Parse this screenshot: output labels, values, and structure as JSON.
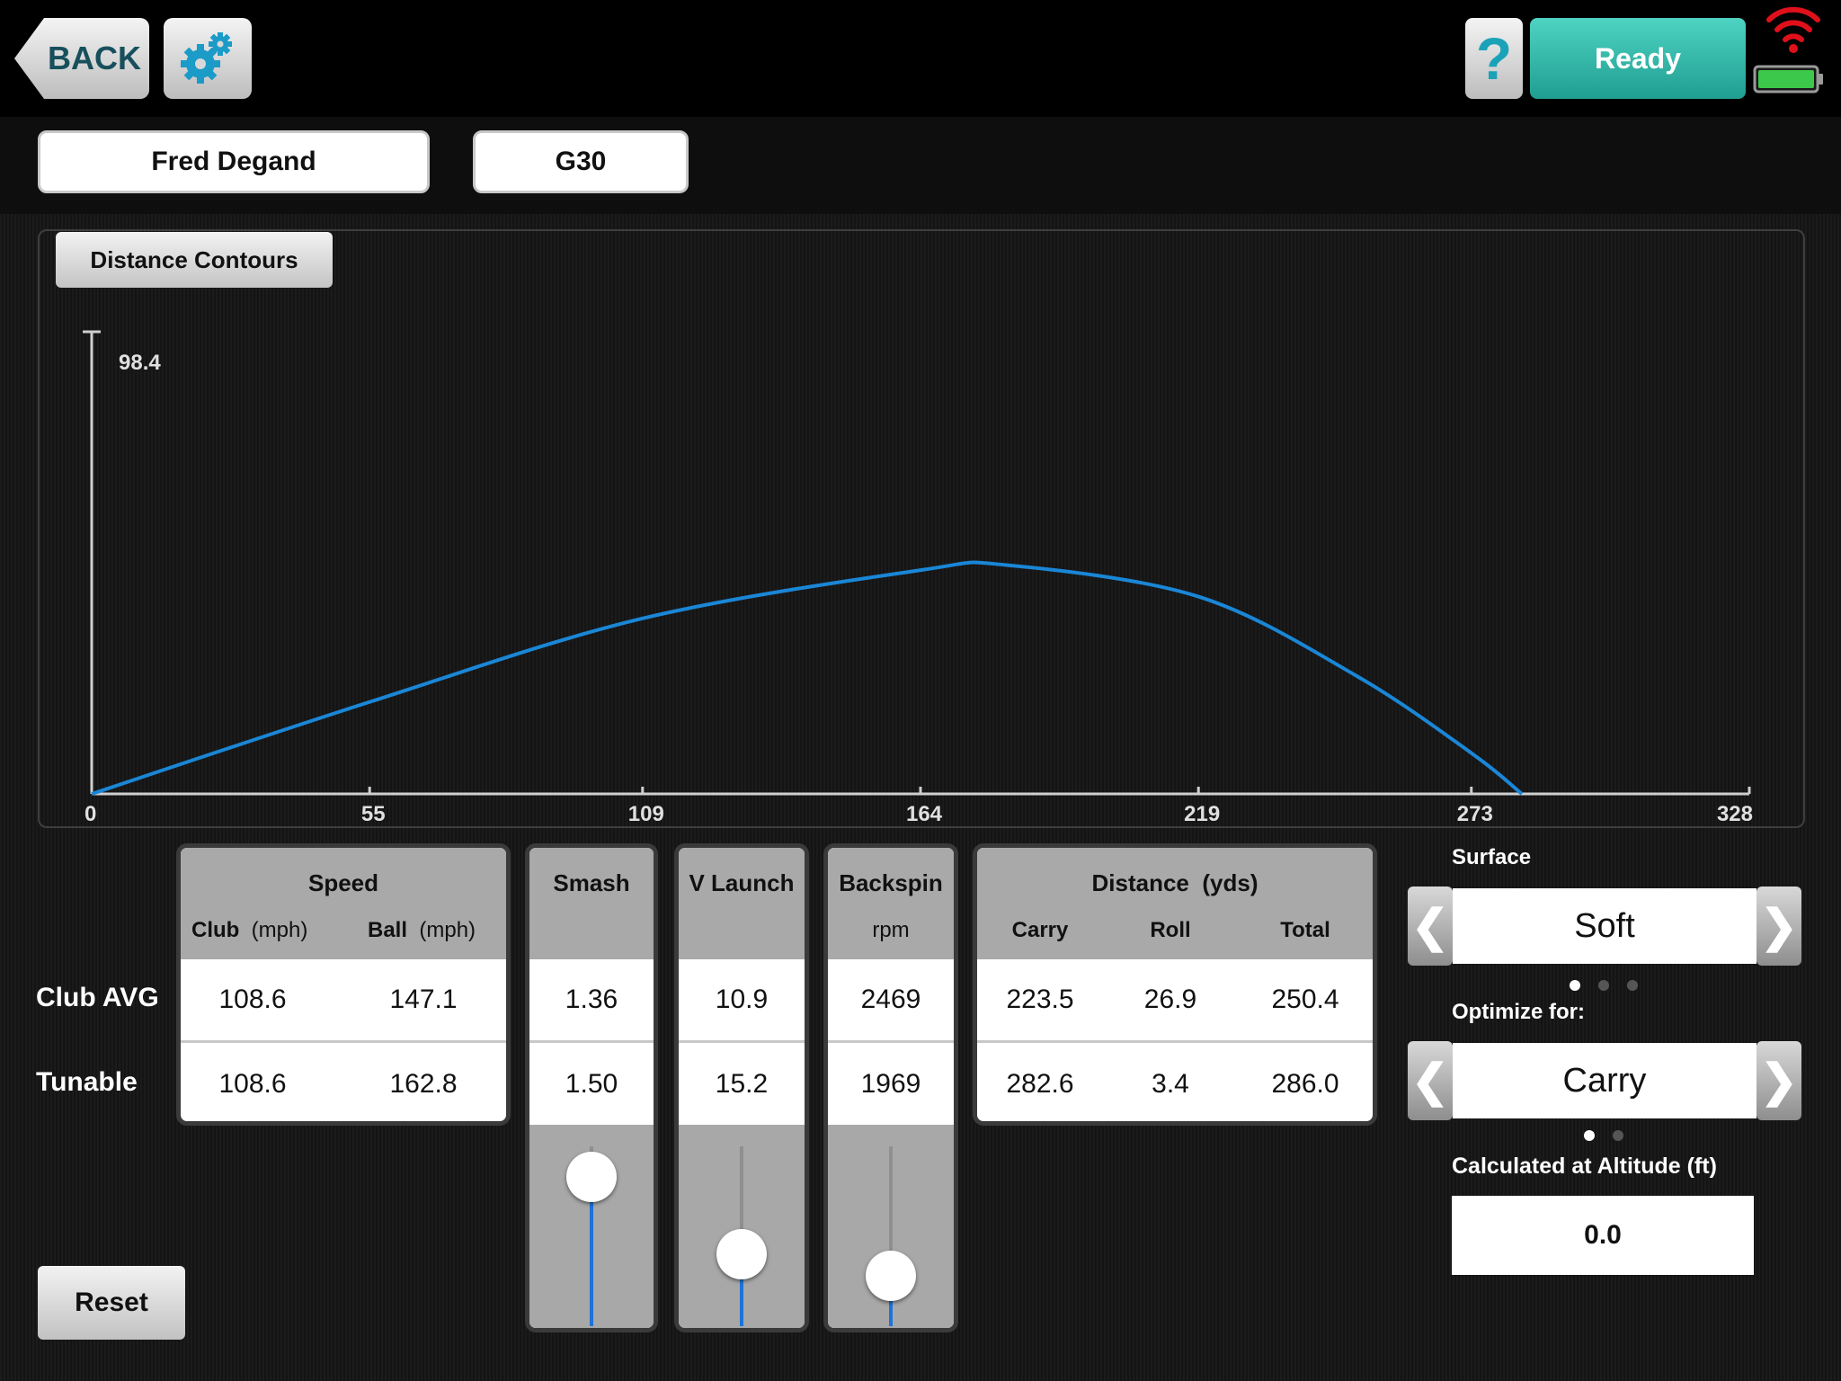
{
  "header": {
    "back_label": "BACK",
    "help_label": "?",
    "status_label": "Ready"
  },
  "selectors": {
    "player": "Fred Degand",
    "club": "G30"
  },
  "chart_tab_label": "Distance Contours",
  "chart_data": {
    "type": "line",
    "title": "Distance Contours",
    "y_max_label": "98.4",
    "xlim": [
      0,
      328
    ],
    "ylim": [
      0,
      98.4
    ],
    "x_ticks": [
      "0",
      "55",
      "109",
      "164",
      "219",
      "273",
      "328"
    ],
    "series": [
      {
        "color": "#1a86d6",
        "points": [
          [
            0,
            0
          ],
          [
            55,
            19.8
          ],
          [
            109,
            37.8
          ],
          [
            164,
            48.2
          ],
          [
            181,
            49.3
          ],
          [
            219,
            42.5
          ],
          [
            250,
            25.6
          ],
          [
            273,
            8.8
          ],
          [
            283,
            0
          ]
        ]
      }
    ]
  },
  "speed": {
    "title": "Speed",
    "club_label": "Club",
    "club_unit": "(mph)",
    "ball_label": "Ball",
    "ball_unit": "(mph)"
  },
  "row_labels": {
    "club_avg": "Club AVG",
    "tunable": "Tunable"
  },
  "rows": {
    "club_avg": {
      "club_speed": "108.6",
      "ball_speed": "147.1",
      "smash": "1.36",
      "v_launch": "10.9",
      "backspin": "2469",
      "carry": "223.5",
      "roll": "26.9",
      "total": "250.4"
    },
    "tunable": {
      "club_speed": "108.6",
      "ball_speed": "162.8",
      "smash": "1.50",
      "v_launch": "15.2",
      "backspin": "1969",
      "carry": "282.6",
      "roll": "3.4",
      "total": "286.0"
    }
  },
  "smash": {
    "title": "Smash",
    "slider_level": 0.83
  },
  "v_launch": {
    "title": "V Launch",
    "slider_level": 0.4
  },
  "backspin": {
    "title": "Backspin",
    "unit": "rpm",
    "slider_level": 0.28
  },
  "distance": {
    "title": "Distance",
    "unit": "(yds)",
    "carry_label": "Carry",
    "roll_label": "Roll",
    "total_label": "Total"
  },
  "surface": {
    "label": "Surface",
    "value": "Soft",
    "page_count": 3,
    "page_index": 0
  },
  "optimize": {
    "label": "Optimize for:",
    "value": "Carry",
    "page_count": 2,
    "page_index": 0
  },
  "altitude": {
    "label": "Calculated at Altitude (ft)",
    "value": "0.0"
  },
  "reset_label": "Reset",
  "arrows": {
    "prev": "❮",
    "next": "❯"
  },
  "colors": {
    "ready": "#2cb8a8",
    "accent": "#1a86d6",
    "wifi": "#e0101a",
    "battery": "#3cc84a"
  }
}
